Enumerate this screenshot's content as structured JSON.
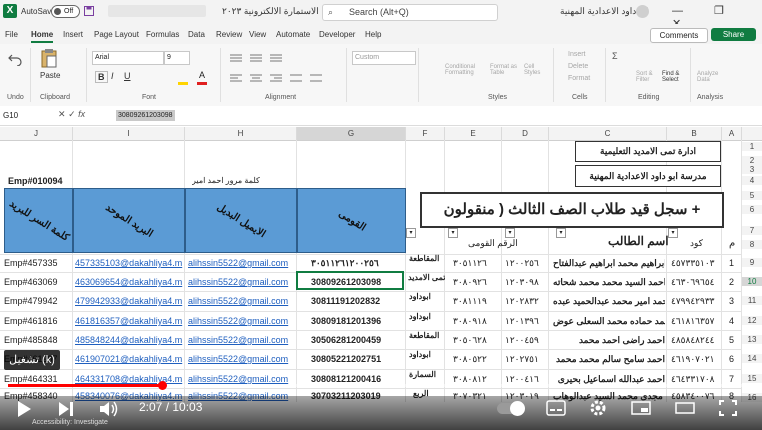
{
  "titlebar": {
    "logo": "X",
    "autosave_label": "AutoSave",
    "autosave_state": "Off",
    "file_title": "الاستمارة الالكترونية ٢٠٢٣",
    "search_placeholder": "Search (Alt+Q)",
    "user_name": "ابو داود الاعدادية المهنية",
    "window_controls": "—  ❐  ✕"
  },
  "menu": {
    "file": "File",
    "home": "Home",
    "insert": "Insert",
    "page_layout": "Page Layout",
    "formulas": "Formulas",
    "data": "Data",
    "review": "Review",
    "view": "View",
    "automate": "Automate",
    "developer": "Developer",
    "help": "Help",
    "comments": "Comments",
    "share": "Share"
  },
  "ribbon": {
    "undo": "Undo",
    "clipboard": "Clipboard",
    "paste": "Paste",
    "font_group": "Font",
    "alignment": "Alignment",
    "styles": "Styles",
    "cells": "Cells",
    "editing": "Editing",
    "analysis": "Analysis",
    "font_name": "Arial",
    "font_size": "9",
    "number_format": "Custom",
    "conditional_formatting": "Conditional Formatting",
    "format_as_table": "Format as Table",
    "cell_styles": "Cell Styles",
    "insert": "Insert",
    "delete": "Delete",
    "format": "Format",
    "sort_filter": "Sort & Filter",
    "find_select": "Find & Select",
    "analyze_data": "Analyze Data",
    "bold": "B",
    "italic": "I",
    "underline": "U"
  },
  "formula_bar": {
    "name_box": "G10",
    "fx": "fx",
    "content": "30809261203098"
  },
  "columns": [
    "J",
    "I",
    "H",
    "G",
    "F",
    "E",
    "D",
    "C",
    "B",
    "A"
  ],
  "rows": [
    "1",
    "2",
    "3",
    "4",
    "5",
    "6",
    "7",
    "8",
    "9",
    "10",
    "11",
    "12",
    "13",
    "14",
    "15",
    "16"
  ],
  "sheet": {
    "emp_id": "Emp#010094",
    "password_label": "كلمة مرور احمد امير",
    "admin_box": "ادارة تمى الامديد التعليمية",
    "school_box": "مدرسة ابو داود الاعدادية المهنية",
    "register_title": "سجل قيد طلاب الصف الثالث ( منقولون +",
    "hdr_j": "كلمة السر للبريد",
    "hdr_i": "البريد الموحد",
    "hdr_h": "الايميل البديل",
    "hdr_g": "القومى",
    "col_e_header": "الرقم القومى",
    "col_c_header": "اسم الطالب",
    "col_b_header": "كود",
    "col_a_header": "م",
    "records": [
      {
        "emp": "Emp#457335",
        "unified": "457335103@dakahliya4.m",
        "alt": "alihssin5522@gmail.com",
        "national": "٣٠٥١١٢٦١٢٠٠٢٥٦",
        "region": "المقاطعة",
        "e": "٣٠٥١١٢٦",
        "d": "١٢٠٠٢٥٦",
        "name": "ابراهيم محمد ابراهيم عبدالفتاح",
        "code": "٤٥٧٣٣٥١٠٣",
        "idx": "1"
      },
      {
        "emp": "Emp#463069",
        "unified": "463069654@dakahliya4.m",
        "alt": "alihssin5522@gmail.com",
        "national": "30809261203098",
        "region": "تمى الامديد",
        "e": "٣٠٨٠٩٢٦",
        "d": "١٢٠٣٠٩٨",
        "name": "احمد السيد محمد محمد شحاته",
        "code": "٤٦٣٠٦٩٦٥٤",
        "idx": "2"
      },
      {
        "emp": "Emp#479942",
        "unified": "479942933@dakahliya4.m",
        "alt": "alihssin5522@gmail.com",
        "national": "30811191202832",
        "region": "ابوداود",
        "e": "٣٠٨١١١٩",
        "d": "١٢٠٢٨٣٢",
        "name": "احمد امير محمد عبدالحميد عبده",
        "code": "٤٧٩٩٤٢٩٣٣",
        "idx": "3"
      },
      {
        "emp": "Emp#461816",
        "unified": "461816357@dakahliya4.m",
        "alt": "alihssin5522@gmail.com",
        "national": "30809181201396",
        "region": "ابوداود",
        "e": "٣٠٨٠٩١٨",
        "d": "١٢٠١٣٩٦",
        "name": "احمد حماده محمد السعلى عوض",
        "code": "٤٦١٨١٦٣٥٧",
        "idx": "4"
      },
      {
        "emp": "Emp#485848",
        "unified": "485848244@dakahliya4.m",
        "alt": "alihssin5522@gmail.com",
        "national": "30506281200459",
        "region": "المقاطعة",
        "e": "٣٠٥٠٦٢٨",
        "d": "١٢٠٠٤٥٩",
        "name": "احمد راضى احمد محمد",
        "code": "٤٨٥٨٤٨٢٤٤",
        "idx": "5"
      },
      {
        "emp": "Emp#461907",
        "unified": "461907021@dakahliya4.m",
        "alt": "alihssin5522@gmail.com",
        "national": "30805221202751",
        "region": "ابوداود",
        "e": "٣٠٨٠٥٢٢",
        "d": "١٢٠٢٧٥١",
        "name": "احمد سامح سالم محمد محمد",
        "code": "٤٦١٩٠٧٠٢١",
        "idx": "6"
      },
      {
        "emp": "Emp#464331",
        "unified": "464331708@dakahliya4.m",
        "alt": "alihssin5522@gmail.com",
        "national": "30808121200416",
        "region": "السمارة",
        "e": "٣٠٨٠٨١٢",
        "d": "١٢٠٠٤١٦",
        "name": "احمد عبدالله اسماعيل بحيرى",
        "code": "٤٦٤٣٣١٧٠٨",
        "idx": "7"
      },
      {
        "emp": "Emp#458340",
        "unified": "458340076@dakahliya4.m",
        "alt": "alihssin5522@gmail.com",
        "national": "30703211203019",
        "region": "الربع",
        "e": "٣٠٧٠٣٢١",
        "d": "١٢٠٣٠١٩",
        "name": "احمد مجدى محمد السيد عبدالوهاب",
        "code": "٤٥٨٣٤٠٠٧٦",
        "idx": "8"
      }
    ]
  },
  "video": {
    "subtitle_button": "تشغيل (k)",
    "time": "2:07 / 10:03",
    "progress": 0.21,
    "status_text": "Accessibility: Investigate"
  }
}
